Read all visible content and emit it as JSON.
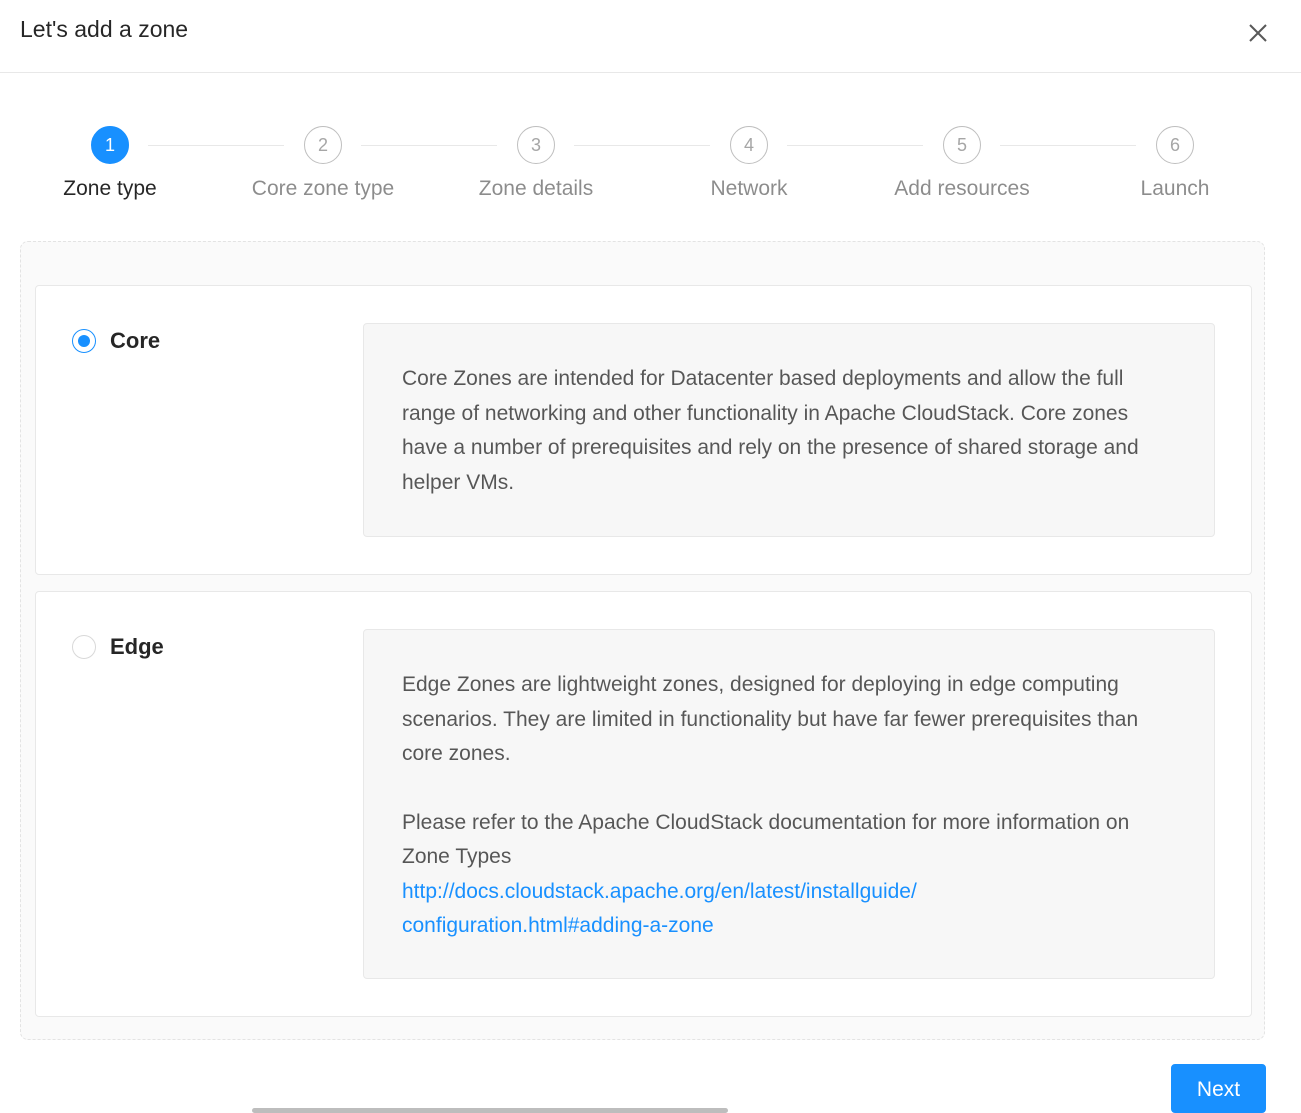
{
  "modal": {
    "title": "Let's add a zone",
    "close_icon": "close-icon"
  },
  "steps": [
    {
      "number": "1",
      "label": "Zone type",
      "active": true
    },
    {
      "number": "2",
      "label": "Core zone type",
      "active": false
    },
    {
      "number": "3",
      "label": "Zone details",
      "active": false
    },
    {
      "number": "4",
      "label": "Network",
      "active": false
    },
    {
      "number": "5",
      "label": "Add resources",
      "active": false
    },
    {
      "number": "6",
      "label": "Launch",
      "active": false
    }
  ],
  "options": {
    "core": {
      "label": "Core",
      "selected": true,
      "description": "Core Zones are intended for Datacenter based deployments and allow the full range of networking and other functionality in Apache CloudStack. Core zones have a number of prerequisites and rely on the presence of shared storage and helper VMs."
    },
    "edge": {
      "label": "Edge",
      "selected": false,
      "description": "Edge Zones are lightweight zones, designed for deploying in edge computing scenarios. They are limited in functionality but have far fewer prerequisites than core zones.",
      "doc_text": "Please refer to the Apache CloudStack documentation for more information on Zone Types",
      "doc_link_line1": "http://docs.cloudstack.apache.org/en/latest/installguide/",
      "doc_link_line2": "configuration.html#adding-a-zone"
    }
  },
  "footer": {
    "next_label": "Next"
  },
  "colors": {
    "accent": "#1890ff",
    "step_inactive": "#bfbfbf"
  }
}
